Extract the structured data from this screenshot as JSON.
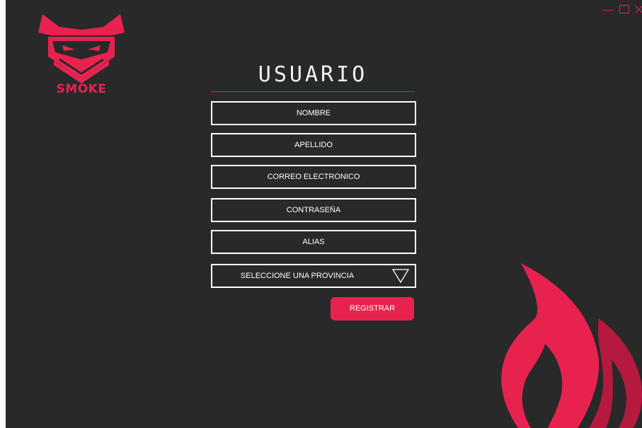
{
  "window": {
    "controls": [
      "minimize",
      "maximize",
      "close"
    ]
  },
  "brand": {
    "name": "SMOKE",
    "logo_icon": "ninja-mask-shield-icon",
    "accent_color": "#e8224f",
    "background_color": "#292929"
  },
  "form": {
    "title": "USUARIO",
    "fields": {
      "nombre": {
        "value": "",
        "placeholder": "NOMBRE"
      },
      "apellido": {
        "value": "",
        "placeholder": "APELLIDO"
      },
      "correo": {
        "value": "",
        "placeholder": "CORREO ELECTRÓNICO"
      },
      "contrasena": {
        "value": "",
        "placeholder": "CONTRASEÑA"
      },
      "alias": {
        "value": "",
        "placeholder": "ALIAS"
      }
    },
    "provincia_select": {
      "selected": "SELECCIONE UNA PROVINCIA",
      "icon": "triangle-down-icon"
    },
    "submit_label": "REGISTRAR"
  },
  "decoration": {
    "icon": "flame-icon"
  }
}
